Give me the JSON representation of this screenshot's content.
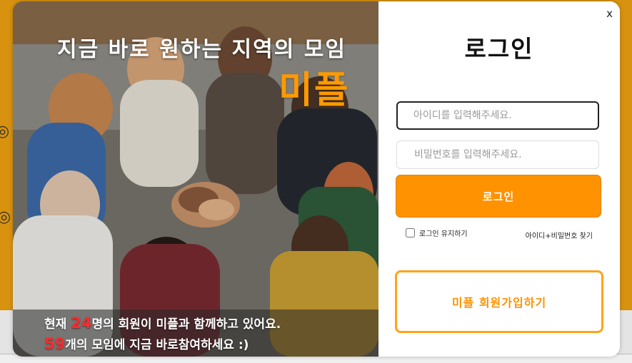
{
  "promo": {
    "headline": "지금 바로 원하는 지역의 모임",
    "brand": "미플",
    "stats_line1_prefix": "현재 ",
    "member_count": "24",
    "stats_line1_suffix": "명의 회원이 미플과 함께하고 있어요.",
    "meeting_count": "59",
    "stats_line2_suffix": "개의 모임에 지금 바로참여하세요 :)"
  },
  "login": {
    "close_label": "x",
    "title": "로그인",
    "id_placeholder": "아이디를 입력해주세요.",
    "password_placeholder": "비밀번호를 입력해주세요.",
    "login_button": "로그인",
    "remember_label": "로그인 유지하기",
    "find_link": "아이디+비밀번호 찾기",
    "signup_button": "미플 회원가입하기"
  },
  "colors": {
    "accent": "#ff9200",
    "number_highlight": "#ff2a2a",
    "backdrop": "#d8920f"
  }
}
